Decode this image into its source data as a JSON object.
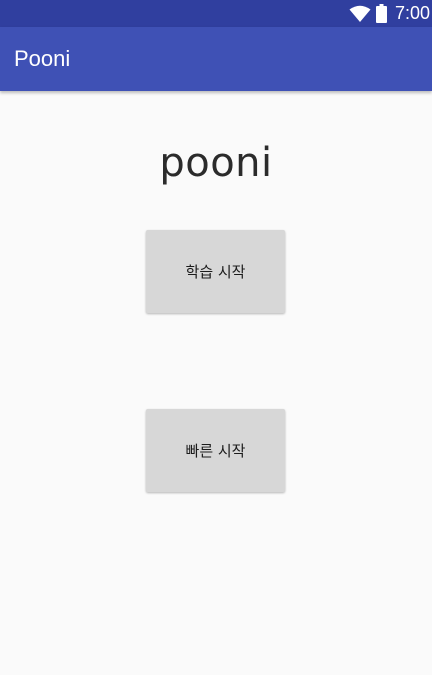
{
  "status_bar": {
    "time": "7:00",
    "icons": [
      "wifi-icon",
      "battery-icon"
    ],
    "color": "#303f9f"
  },
  "app_bar": {
    "title": "Pooni",
    "color": "#3f51b5"
  },
  "main": {
    "logo_text": "pooni",
    "buttons": [
      {
        "label": "학습 시작"
      },
      {
        "label": "빠른 시작"
      }
    ]
  }
}
